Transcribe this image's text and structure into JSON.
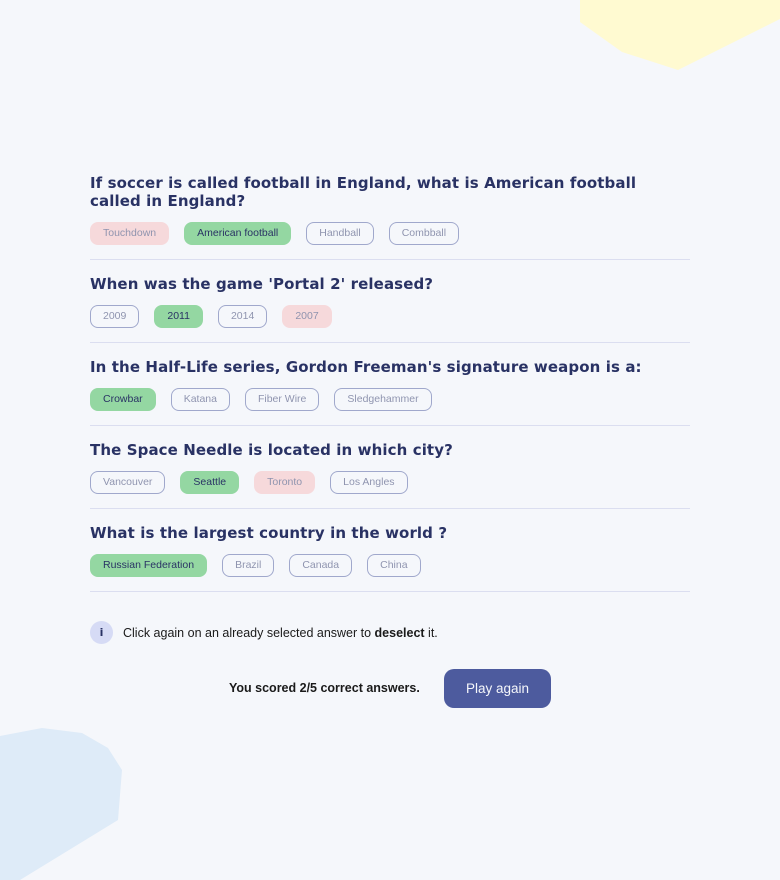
{
  "questions": [
    {
      "text": "If soccer is called football in England, what is American football called in England?",
      "answers": [
        {
          "label": "Touchdown",
          "state": "wrong"
        },
        {
          "label": "American football",
          "state": "correct"
        },
        {
          "label": "Handball",
          "state": "neutral"
        },
        {
          "label": "Combball",
          "state": "neutral"
        }
      ]
    },
    {
      "text": "When was the game 'Portal 2' released?",
      "answers": [
        {
          "label": "2009",
          "state": "neutral"
        },
        {
          "label": "2011",
          "state": "correct"
        },
        {
          "label": "2014",
          "state": "neutral"
        },
        {
          "label": "2007",
          "state": "wrong"
        }
      ]
    },
    {
      "text": "In the Half-Life series, Gordon Freeman's signature weapon is a:",
      "answers": [
        {
          "label": "Crowbar",
          "state": "correct"
        },
        {
          "label": "Katana",
          "state": "neutral"
        },
        {
          "label": "Fiber Wire",
          "state": "neutral"
        },
        {
          "label": "Sledgehammer",
          "state": "neutral"
        }
      ]
    },
    {
      "text": "The Space Needle is located in which city?",
      "answers": [
        {
          "label": "Vancouver",
          "state": "neutral"
        },
        {
          "label": "Seattle",
          "state": "correct"
        },
        {
          "label": "Toronto",
          "state": "wrong"
        },
        {
          "label": "Los Angles",
          "state": "neutral"
        }
      ]
    },
    {
      "text": "What is the largest country in the world ?",
      "answers": [
        {
          "label": "Russian Federation",
          "state": "correct"
        },
        {
          "label": "Brazil",
          "state": "neutral"
        },
        {
          "label": "Canada",
          "state": "neutral"
        },
        {
          "label": "China",
          "state": "neutral"
        }
      ]
    }
  ],
  "info": {
    "icon_label": "i",
    "text_before": "Click again on an already selected answer to ",
    "text_bold": "deselect",
    "text_after": " it."
  },
  "score": {
    "text": "You scored 2/5 correct answers."
  },
  "play_again_label": "Play again",
  "colors": {
    "background": "#f5f7fb",
    "correct": "#94d7a2",
    "wrong": "#f8bcbc",
    "primary": "#4d5b9e",
    "blob_yellow": "#fffad1",
    "blob_blue": "#deebf8"
  }
}
